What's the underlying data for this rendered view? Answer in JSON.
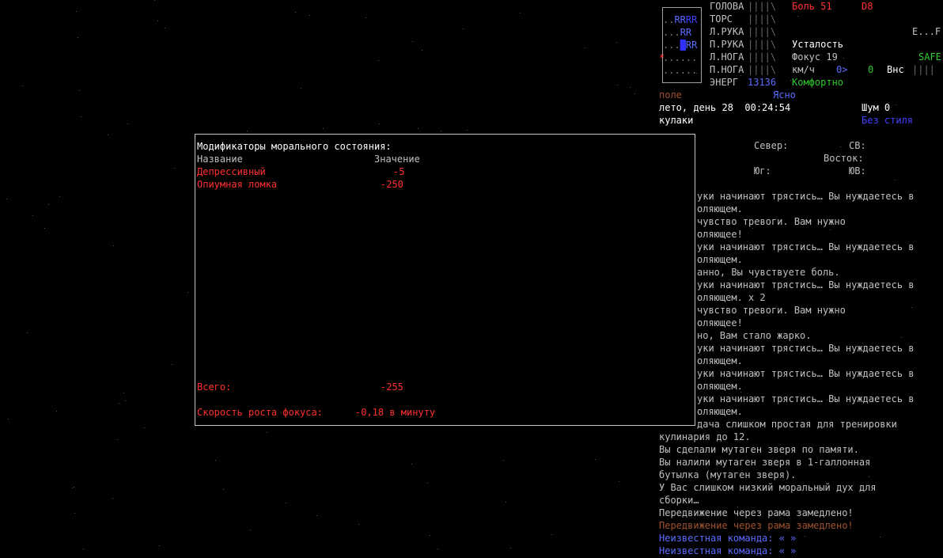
{
  "status": {
    "body_parts": [
      {
        "name": "ГОЛОВА",
        "bar": "||||\\"
      },
      {
        "name": "ТОРС",
        "bar": "||||\\"
      },
      {
        "name": "Л.РУКА",
        "bar": "||||\\"
      },
      {
        "name": "П.РУКА",
        "bar": "||||\\"
      },
      {
        "name": "Л.НОГА",
        "bar": "||||\\"
      },
      {
        "name": "П.НОГА",
        "bar": "||||\\"
      }
    ],
    "energy_label": "ЭНЕРГ",
    "energy_value": "13136",
    "pain": "Боль 51",
    "pain_grade": "D8",
    "fatigue": "Усталость",
    "focus": "Фокус 19",
    "speed_label": "км/ч",
    "speed_value": "0>",
    "speed_zero": "0",
    "outside_label": "Внс",
    "outside_bar": "||||",
    "comfort": "Комфортно",
    "compass_right": "E...F",
    "safe": "SAFE"
  },
  "minimap": {
    "rows": [
      "..RRRR",
      "...RR",
      "...RR",
      "",
      "*.....",
      "......"
    ]
  },
  "environment": {
    "terrain": "поле",
    "weather": "Ясно",
    "date_time": "лето, день 28  00:24:54",
    "noise": "Шум 0",
    "weapon": "кулаки",
    "style": "Без стиля"
  },
  "compass": {
    "north": "Север:",
    "northeast": "СВ:",
    "east": "Восток:",
    "south": "Юг:",
    "southeast": "ЮВ:"
  },
  "log": [
    {
      "text": "уки начинают трястись… Вы нуждаетесь в",
      "color": "gray"
    },
    {
      "text": "оляющем.",
      "color": "gray"
    },
    {
      "text": "чувство тревоги. Вам нужно",
      "color": "gray"
    },
    {
      "text": "оляющее!",
      "color": "gray"
    },
    {
      "text": "уки начинают трястись… Вы нуждаетесь в",
      "color": "gray"
    },
    {
      "text": "оляющем.",
      "color": "gray"
    },
    {
      "text": "анно, Вы чувствуете боль.",
      "color": "gray"
    },
    {
      "text": "уки начинают трястись… Вы нуждаетесь в",
      "color": "gray"
    },
    {
      "text": "оляющем. x 2",
      "color": "gray"
    },
    {
      "text": "чувство тревоги. Вам нужно",
      "color": "gray"
    },
    {
      "text": "оляющее!",
      "color": "gray"
    },
    {
      "text": "но, Вам стало жарко.",
      "color": "gray"
    },
    {
      "text": "уки начинают трястись… Вы нуждаетесь в",
      "color": "gray"
    },
    {
      "text": "оляющем.",
      "color": "gray"
    },
    {
      "text": "уки начинают трястись… Вы нуждаетесь в",
      "color": "gray"
    },
    {
      "text": "оляющем.",
      "color": "gray"
    },
    {
      "text": "уки начинают трястись… Вы нуждаетесь в",
      "color": "gray"
    },
    {
      "text": "оляющем.",
      "color": "gray"
    },
    {
      "text": "дача слишком простая для тренировки",
      "color": "gray"
    }
  ],
  "log_full": [
    {
      "text": "кулинария до 12.",
      "color": "gray"
    },
    {
      "text": "Вы сделали мутаген зверя по памяти.",
      "color": "gray"
    },
    {
      "text": "Вы налили мутаген зверя в 1-галлонная",
      "color": "gray"
    },
    {
      "text": "бутылка (мутаген зверя).",
      "color": "gray"
    },
    {
      "text": "У Вас слишком низкий моральный дух для",
      "color": "gray"
    },
    {
      "text": "сборки…",
      "color": "gray"
    },
    {
      "text": "Передвижение через рама замедлено!",
      "color": "gray"
    },
    {
      "text": "Передвижение через рама замедлено!",
      "color": "brown"
    },
    {
      "text": "Неизвестная команда: « »",
      "color": "blue"
    },
    {
      "text": "Неизвестная команда: « »",
      "color": "blue"
    }
  ],
  "morale": {
    "title": "Модификаторы морального состояния:",
    "col_name": "Название",
    "col_value": "Значение",
    "rows": [
      {
        "name": "Депрессивный",
        "value": "-5"
      },
      {
        "name": "Опиумная ломка",
        "value": "-250"
      }
    ],
    "total_label": "Всего:",
    "total_value": "-255",
    "focus_rate_label": "Скорость роста фокуса:",
    "focus_rate_value": "-0,18 в минуту"
  }
}
